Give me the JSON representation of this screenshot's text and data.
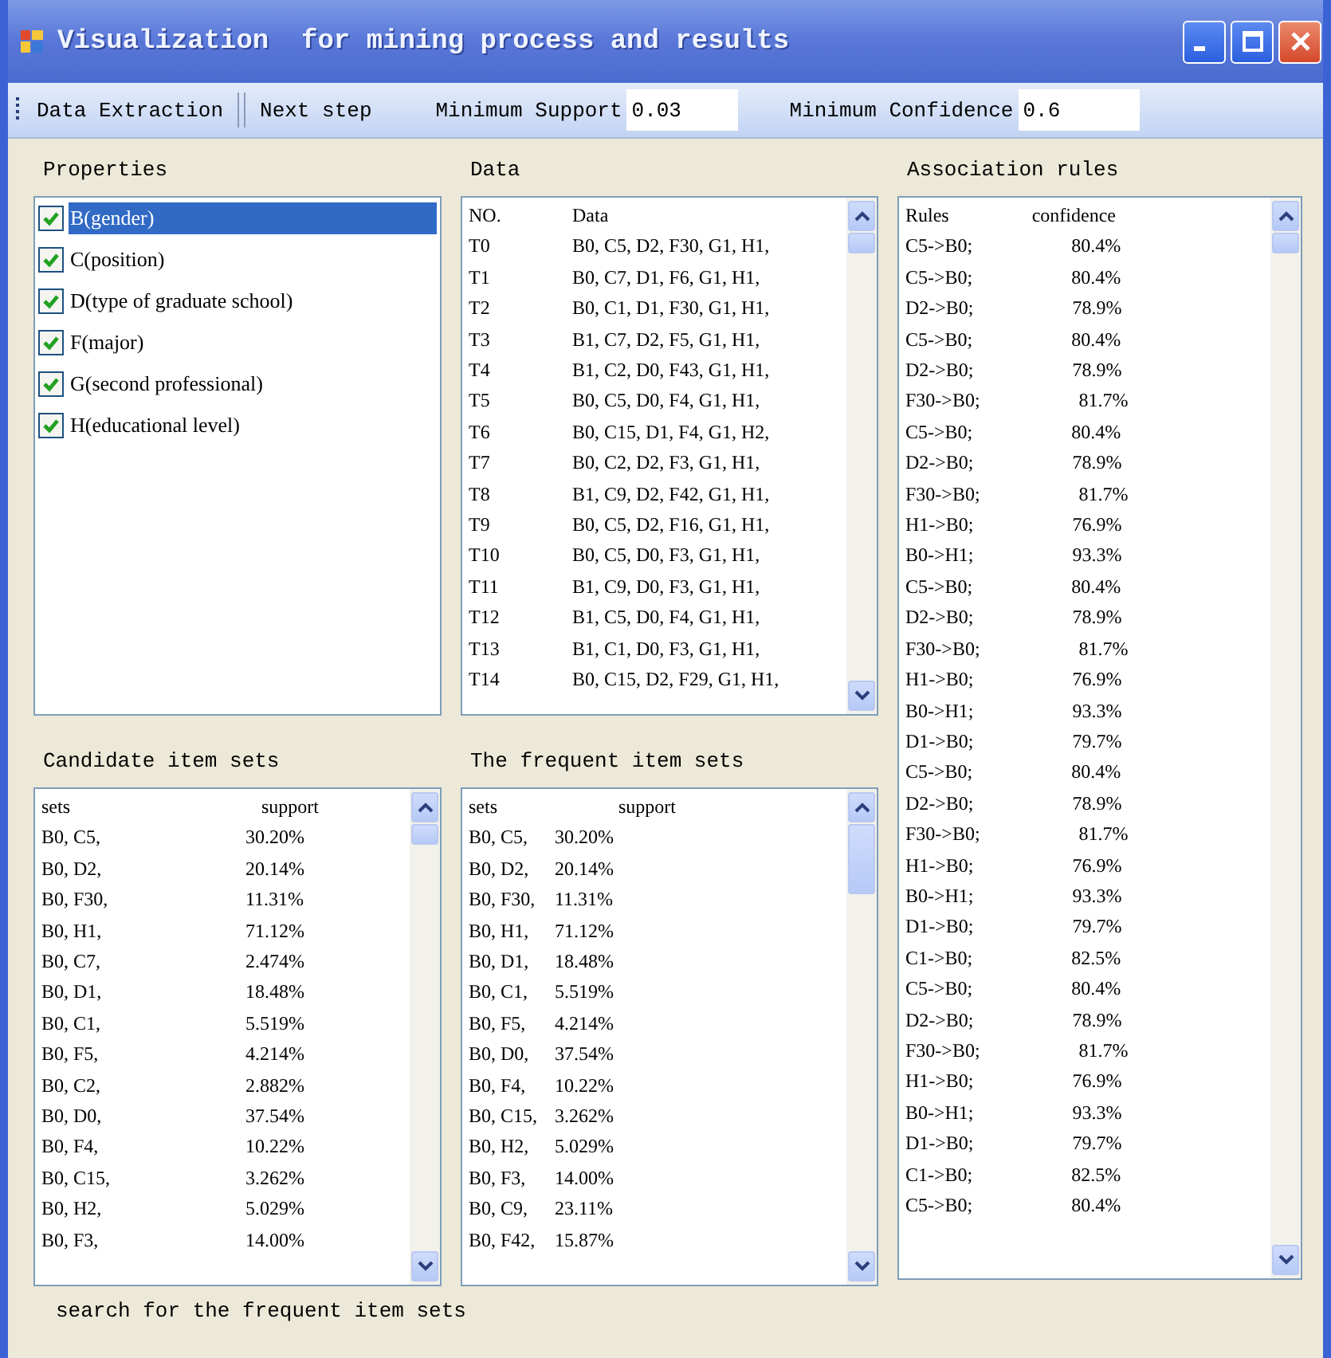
{
  "window": {
    "title": "Visualization  for mining process and results"
  },
  "toolbar": {
    "buttons": [
      "Data Extraction",
      "Next step"
    ],
    "fields": [
      {
        "label": "Minimum Support",
        "value": "0.03"
      },
      {
        "label": "Minimum Confidence",
        "value": "0.6"
      }
    ]
  },
  "properties": {
    "title": "Properties",
    "items": [
      {
        "label": "B(gender)",
        "checked": true,
        "selected": true
      },
      {
        "label": "C(position)",
        "checked": true,
        "selected": false
      },
      {
        "label": "D(type of graduate school)",
        "checked": true,
        "selected": false
      },
      {
        "label": "F(major)",
        "checked": true,
        "selected": false
      },
      {
        "label": "G(second professional)",
        "checked": true,
        "selected": false
      },
      {
        "label": "H(educational level)",
        "checked": true,
        "selected": false
      }
    ]
  },
  "data": {
    "title": "Data",
    "columns": [
      "NO.",
      "Data"
    ],
    "rows": [
      [
        "T0",
        "B0, C5, D2, F30, G1, H1,"
      ],
      [
        "T1",
        "B0, C7, D1, F6, G1, H1,"
      ],
      [
        "T2",
        "B0, C1, D1, F30, G1, H1,"
      ],
      [
        "T3",
        "B1, C7, D2, F5, G1, H1,"
      ],
      [
        "T4",
        "B1, C2, D0, F43, G1, H1,"
      ],
      [
        "T5",
        "B0, C5, D0, F4, G1, H1,"
      ],
      [
        "T6",
        "B0, C15, D1, F4, G1, H2,"
      ],
      [
        "T7",
        "B0, C2, D2, F3, G1, H1,"
      ],
      [
        "T8",
        "B1, C9, D2, F42, G1, H1,"
      ],
      [
        "T9",
        "B0, C5, D2, F16, G1, H1,"
      ],
      [
        "T10",
        "B0, C5, D0, F3, G1, H1,"
      ],
      [
        "T11",
        "B1, C9, D0, F3, G1, H1,"
      ],
      [
        "T12",
        "B1, C5, D0, F4, G1, H1,"
      ],
      [
        "T13",
        "B1, C1, D0, F3, G1, H1,"
      ],
      [
        "T14",
        "B0, C15, D2, F29, G1, H1,"
      ]
    ]
  },
  "association_rules": {
    "title": "Association rules",
    "columns": [
      "Rules",
      "confidence"
    ],
    "rows": [
      [
        "C5->B0;",
        "80.4%"
      ],
      [
        "C5->B0;",
        "80.4%"
      ],
      [
        "D2->B0;",
        "78.9%"
      ],
      [
        "C5->B0;",
        "80.4%"
      ],
      [
        "D2->B0;",
        "78.9%"
      ],
      [
        "F30->B0;",
        "81.7%"
      ],
      [
        "C5->B0;",
        "80.4%"
      ],
      [
        "D2->B0;",
        "78.9%"
      ],
      [
        "F30->B0;",
        "81.7%"
      ],
      [
        "H1->B0;",
        "76.9%"
      ],
      [
        "B0->H1;",
        "93.3%"
      ],
      [
        "C5->B0;",
        "80.4%"
      ],
      [
        "D2->B0;",
        "78.9%"
      ],
      [
        "F30->B0;",
        "81.7%"
      ],
      [
        "H1->B0;",
        "76.9%"
      ],
      [
        "B0->H1;",
        "93.3%"
      ],
      [
        "D1->B0;",
        "79.7%"
      ],
      [
        "C5->B0;",
        "80.4%"
      ],
      [
        "D2->B0;",
        "78.9%"
      ],
      [
        "F30->B0;",
        "81.7%"
      ],
      [
        "H1->B0;",
        "76.9%"
      ],
      [
        "B0->H1;",
        "93.3%"
      ],
      [
        "D1->B0;",
        "79.7%"
      ],
      [
        "C1->B0;",
        "82.5%"
      ],
      [
        "C5->B0;",
        "80.4%"
      ],
      [
        "D2->B0;",
        "78.9%"
      ],
      [
        "F30->B0;",
        "81.7%"
      ],
      [
        "H1->B0;",
        "76.9%"
      ],
      [
        "B0->H1;",
        "93.3%"
      ],
      [
        "D1->B0;",
        "79.7%"
      ],
      [
        "C1->B0;",
        "82.5%"
      ],
      [
        "C5->B0;",
        "80.4%"
      ]
    ]
  },
  "candidate_item_sets": {
    "title": "Candidate item sets",
    "columns": [
      "sets",
      "support"
    ],
    "rows": [
      [
        "B0, C5,",
        "30.20%"
      ],
      [
        "B0, D2,",
        "20.14%"
      ],
      [
        "B0, F30,",
        "11.31%"
      ],
      [
        "B0, H1,",
        "71.12%"
      ],
      [
        "B0, C7,",
        "2.474%"
      ],
      [
        "B0, D1,",
        "18.48%"
      ],
      [
        "B0, C1,",
        "5.519%"
      ],
      [
        "B0, F5,",
        "4.214%"
      ],
      [
        "B0, C2,",
        "2.882%"
      ],
      [
        "B0, D0,",
        "37.54%"
      ],
      [
        "B0, F4,",
        "10.22%"
      ],
      [
        "B0, C15,",
        "3.262%"
      ],
      [
        "B0, H2,",
        "5.029%"
      ],
      [
        "B0, F3,",
        "14.00%"
      ]
    ]
  },
  "frequent_item_sets": {
    "title": "The frequent item sets",
    "columns": [
      "sets",
      "support"
    ],
    "rows": [
      [
        "B0, C5,",
        "30.20%"
      ],
      [
        "B0, D2,",
        "20.14%"
      ],
      [
        "B0, F30,",
        "11.31%"
      ],
      [
        "B0, H1,",
        "71.12%"
      ],
      [
        "B0, D1,",
        "18.48%"
      ],
      [
        "B0, C1,",
        "5.519%"
      ],
      [
        "B0, F5,",
        "4.214%"
      ],
      [
        "B0, D0,",
        "37.54%"
      ],
      [
        "B0, F4,",
        "10.22%"
      ],
      [
        "B0, C15,",
        "3.262%"
      ],
      [
        "B0, H2,",
        "5.029%"
      ],
      [
        "B0, F3,",
        "14.00%"
      ],
      [
        "B0, C9,",
        "23.11%"
      ],
      [
        "B0, F42,",
        "15.87%"
      ]
    ]
  },
  "status": "search for the frequent item sets"
}
